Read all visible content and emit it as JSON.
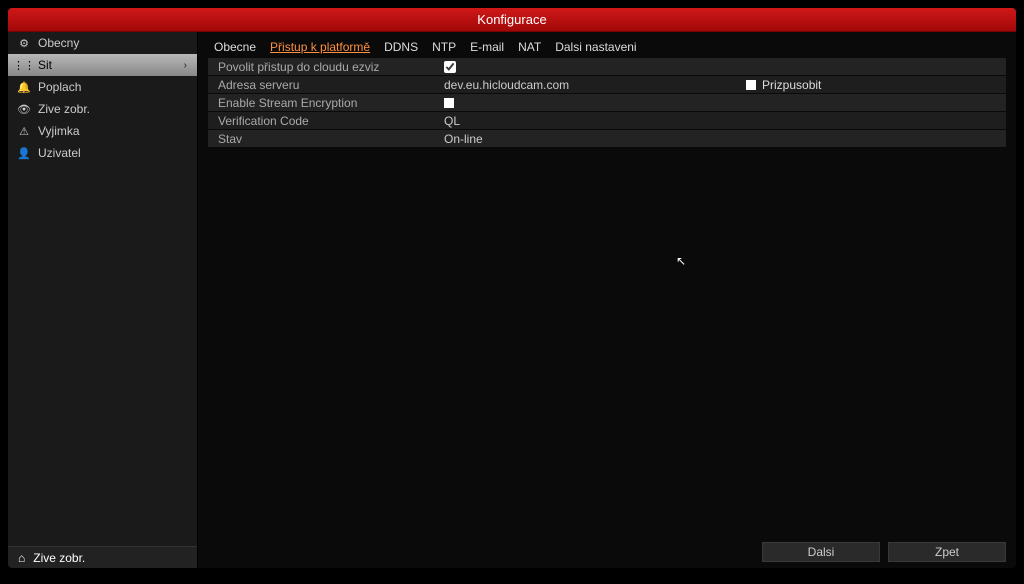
{
  "title": "Konfigurace",
  "sidebar": {
    "items": [
      {
        "icon": "⚙",
        "label": "Obecny",
        "active": false
      },
      {
        "icon": "⋮⋮",
        "label": "Sit",
        "active": true
      },
      {
        "icon": "🔔",
        "label": "Poplach",
        "active": false
      },
      {
        "icon": "👁",
        "label": "Zive zobr.",
        "active": false
      },
      {
        "icon": "⚠",
        "label": "Vyjimka",
        "active": false
      },
      {
        "icon": "👤",
        "label": "Uzivatel",
        "active": false
      }
    ],
    "footer": {
      "icon": "⌂",
      "label": "Zive zobr."
    }
  },
  "tabs": [
    {
      "label": "Obecne",
      "active": false
    },
    {
      "label": "Přistup k platformě",
      "active": true
    },
    {
      "label": "DDNS",
      "active": false
    },
    {
      "label": "NTP",
      "active": false
    },
    {
      "label": "E-mail",
      "active": false
    },
    {
      "label": "NAT",
      "active": false
    },
    {
      "label": "Dalsi nastaveni",
      "active": false
    }
  ],
  "form": {
    "rows": [
      {
        "label": "Povolit přistup do cloudu ezviz",
        "checkbox": true,
        "checked": true
      },
      {
        "label": "Adresa serveru",
        "value": "dev.eu.hicloudcam.com",
        "extra_checkbox": false,
        "extra_label": "Prizpusobit"
      },
      {
        "label": "Enable Stream Encryption",
        "checkbox": true,
        "checked": false
      },
      {
        "label": "Verification Code",
        "value": "QL"
      },
      {
        "label": "Stav",
        "value": "On-line"
      }
    ]
  },
  "buttons": {
    "next": "Dalsi",
    "back": "Zpet"
  }
}
